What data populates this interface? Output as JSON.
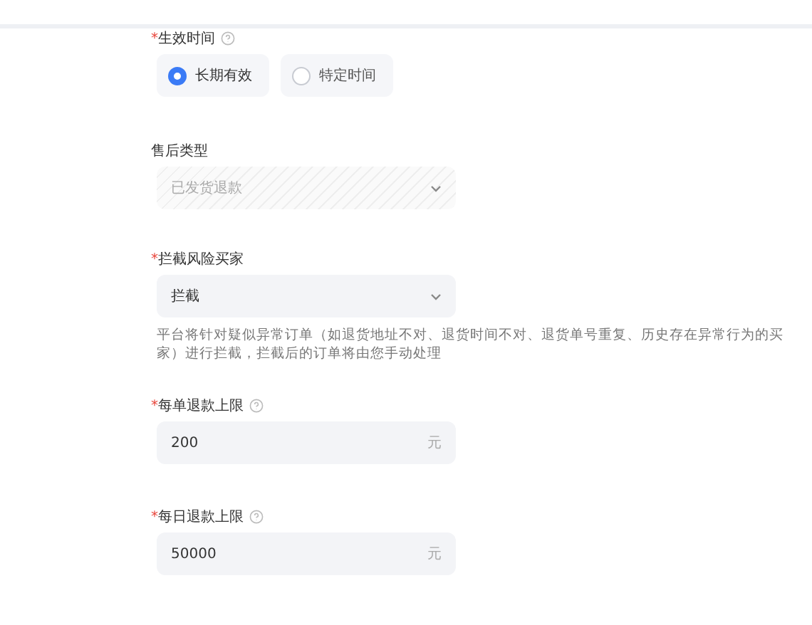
{
  "fields": [
    {
      "kind": "radio",
      "mark": "*",
      "label": "生效时间",
      "help": true,
      "options": [
        {
          "label": "长期有效",
          "selected": true
        },
        {
          "label": "特定时间",
          "selected": false
        }
      ]
    },
    {
      "kind": "select",
      "label": "售后类型",
      "help": false,
      "value": "已发货退款",
      "disabled": true
    },
    {
      "kind": "select",
      "mark": "*",
      "label": "拦截风险买家",
      "help": false,
      "value": "拦截",
      "disabled": false,
      "note": "平台将针对疑似异常订单（如退货地址不对、退货时间不对、退货单号重复、历史存在异常行为的买家）进行拦截，拦截后的订单将由您手动处理"
    },
    {
      "kind": "input",
      "mark": "*",
      "label": "每单退款上限",
      "help": true,
      "value": "200",
      "unit": "元"
    },
    {
      "kind": "input",
      "mark": "*",
      "label": "每日退款上限",
      "help": true,
      "value": "50000",
      "unit": "元"
    }
  ]
}
